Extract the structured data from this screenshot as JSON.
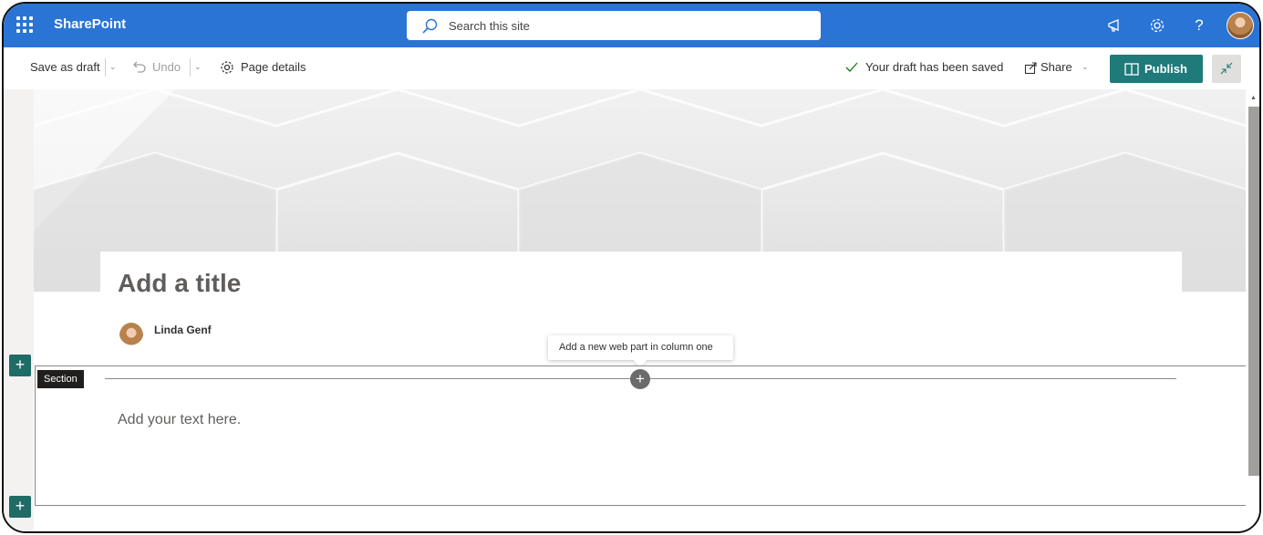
{
  "suitebar": {
    "brand": "SharePoint",
    "search_placeholder": "Search this site",
    "icons": [
      "waffle-icon",
      "search-icon",
      "megaphone-icon",
      "gear-icon",
      "help-icon",
      "avatar"
    ],
    "help_glyph": "?",
    "background_color": "#2a74d6"
  },
  "commandbar": {
    "save_as_draft": "Save as draft",
    "undo": "Undo",
    "page_details": "Page details",
    "status": "Your draft has been saved",
    "share": "Share",
    "publish": "Publish",
    "accent_color": "#1f7a7a"
  },
  "page": {
    "title_placeholder": "Add a title",
    "author": "Linda Genf",
    "tooltip": "Add a new web part in column one",
    "section_label": "Section",
    "text_placeholder": "Add your text here.",
    "add_glyph": "+"
  }
}
